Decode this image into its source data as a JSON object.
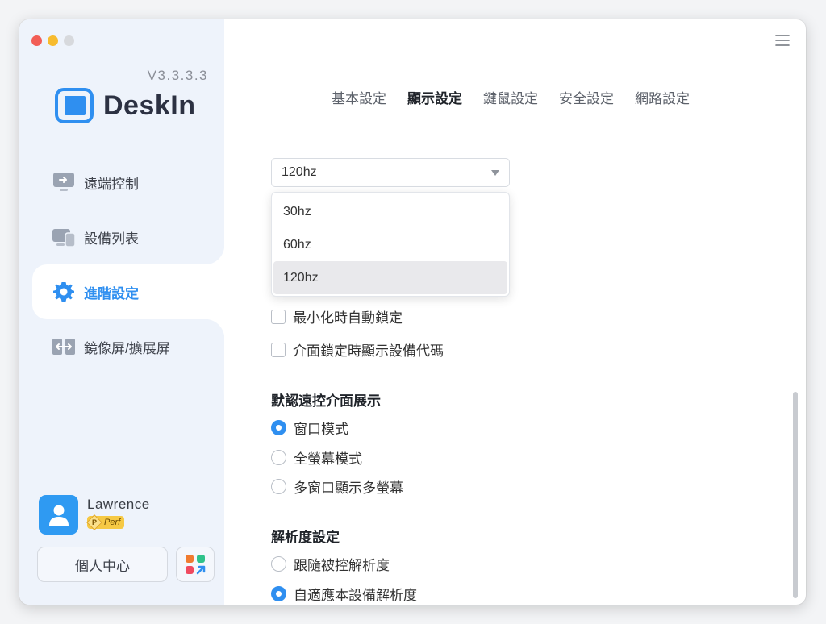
{
  "app": {
    "version": "V3.3.3.3",
    "name": "DeskIn"
  },
  "sidebar": {
    "items": [
      {
        "label": "遠端控制",
        "icon": "remote-monitor-icon"
      },
      {
        "label": "設備列表",
        "icon": "devices-icon"
      },
      {
        "label": "進階設定",
        "icon": "gear-icon",
        "active": true
      },
      {
        "label": "鏡像屏/擴展屏",
        "icon": "mirror-screen-icon"
      }
    ]
  },
  "user": {
    "name": "Lawrence",
    "badge_letter": "P",
    "badge_text": "Perf",
    "center_label": "個人中心"
  },
  "tabs": [
    {
      "label": "基本設定"
    },
    {
      "label": "顯示設定",
      "active": true
    },
    {
      "label": "鍵鼠設定"
    },
    {
      "label": "安全設定"
    },
    {
      "label": "網路設定"
    }
  ],
  "refresh": {
    "selected": "120hz",
    "options": [
      "30hz",
      "60hz",
      "120hz"
    ]
  },
  "lock": {
    "minimize_lock": "最小化時自動鎖定",
    "show_code": "介面鎖定時顯示設備代碼"
  },
  "display_mode": {
    "title": "默認遠控介面展示",
    "options": [
      {
        "label": "窗口模式",
        "checked": true
      },
      {
        "label": "全螢幕模式",
        "checked": false
      },
      {
        "label": "多窗口顯示多螢幕",
        "checked": false
      }
    ]
  },
  "resolution": {
    "title": "解析度設定",
    "options": [
      {
        "label": "跟隨被控解析度",
        "checked": false
      },
      {
        "label": "自適應本設備解析度",
        "checked": true
      }
    ]
  },
  "colors": {
    "accent": "#2f8ff0",
    "sidebar_bg": "#eef3fb"
  }
}
